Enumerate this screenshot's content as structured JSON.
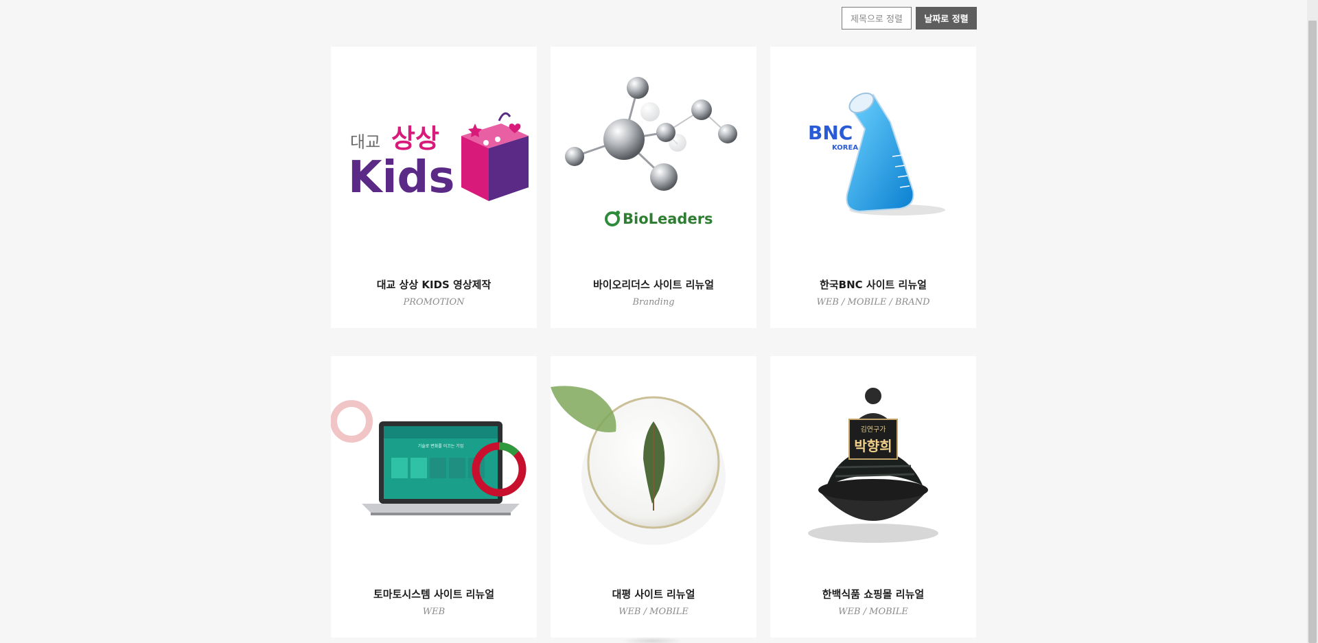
{
  "sort": {
    "by_title_label": "제목으로 정렬",
    "by_date_label": "날짜로 정렬"
  },
  "portfolio": {
    "items": [
      {
        "title": "대교 상상 KIDS 영상제작",
        "category": "PROMOTION",
        "logo": {
          "brand_prefix": "대교",
          "brand_main": "상상",
          "brand_sub": "Kids"
        }
      },
      {
        "title": "바이오리더스 사이트 리뉴얼",
        "category": "Branding",
        "logo": {
          "brand": "BioLeaders"
        }
      },
      {
        "title": "한국BNC 사이트 리뉴얼",
        "category": "WEB / MOBILE / BRAND",
        "logo": {
          "brand": "BNC",
          "brand_sub": "KOREA"
        }
      },
      {
        "title": "토마토시스템 사이트 리뉴얼",
        "category": "WEB",
        "logo": {
          "screen_text": "기술로 변화를 이끄는 기업"
        }
      },
      {
        "title": "대평 사이트 리뉴얼",
        "category": "WEB / MOBILE"
      },
      {
        "title": "한백식품 쇼핑몰 리뉴얼",
        "category": "WEB / MOBILE",
        "logo": {
          "label_top": "김연구가",
          "label_main": "박향희"
        }
      }
    ]
  },
  "colors": {
    "background": "#f6f6f6",
    "card": "#ffffff",
    "sort_active": "#5e5e5e",
    "kids_purple": "#5a2a86",
    "kids_pink": "#d81b7a",
    "bio_green": "#6abf2a",
    "bnc_blue": "#2a5bd7",
    "tomato_red": "#c8102e"
  }
}
